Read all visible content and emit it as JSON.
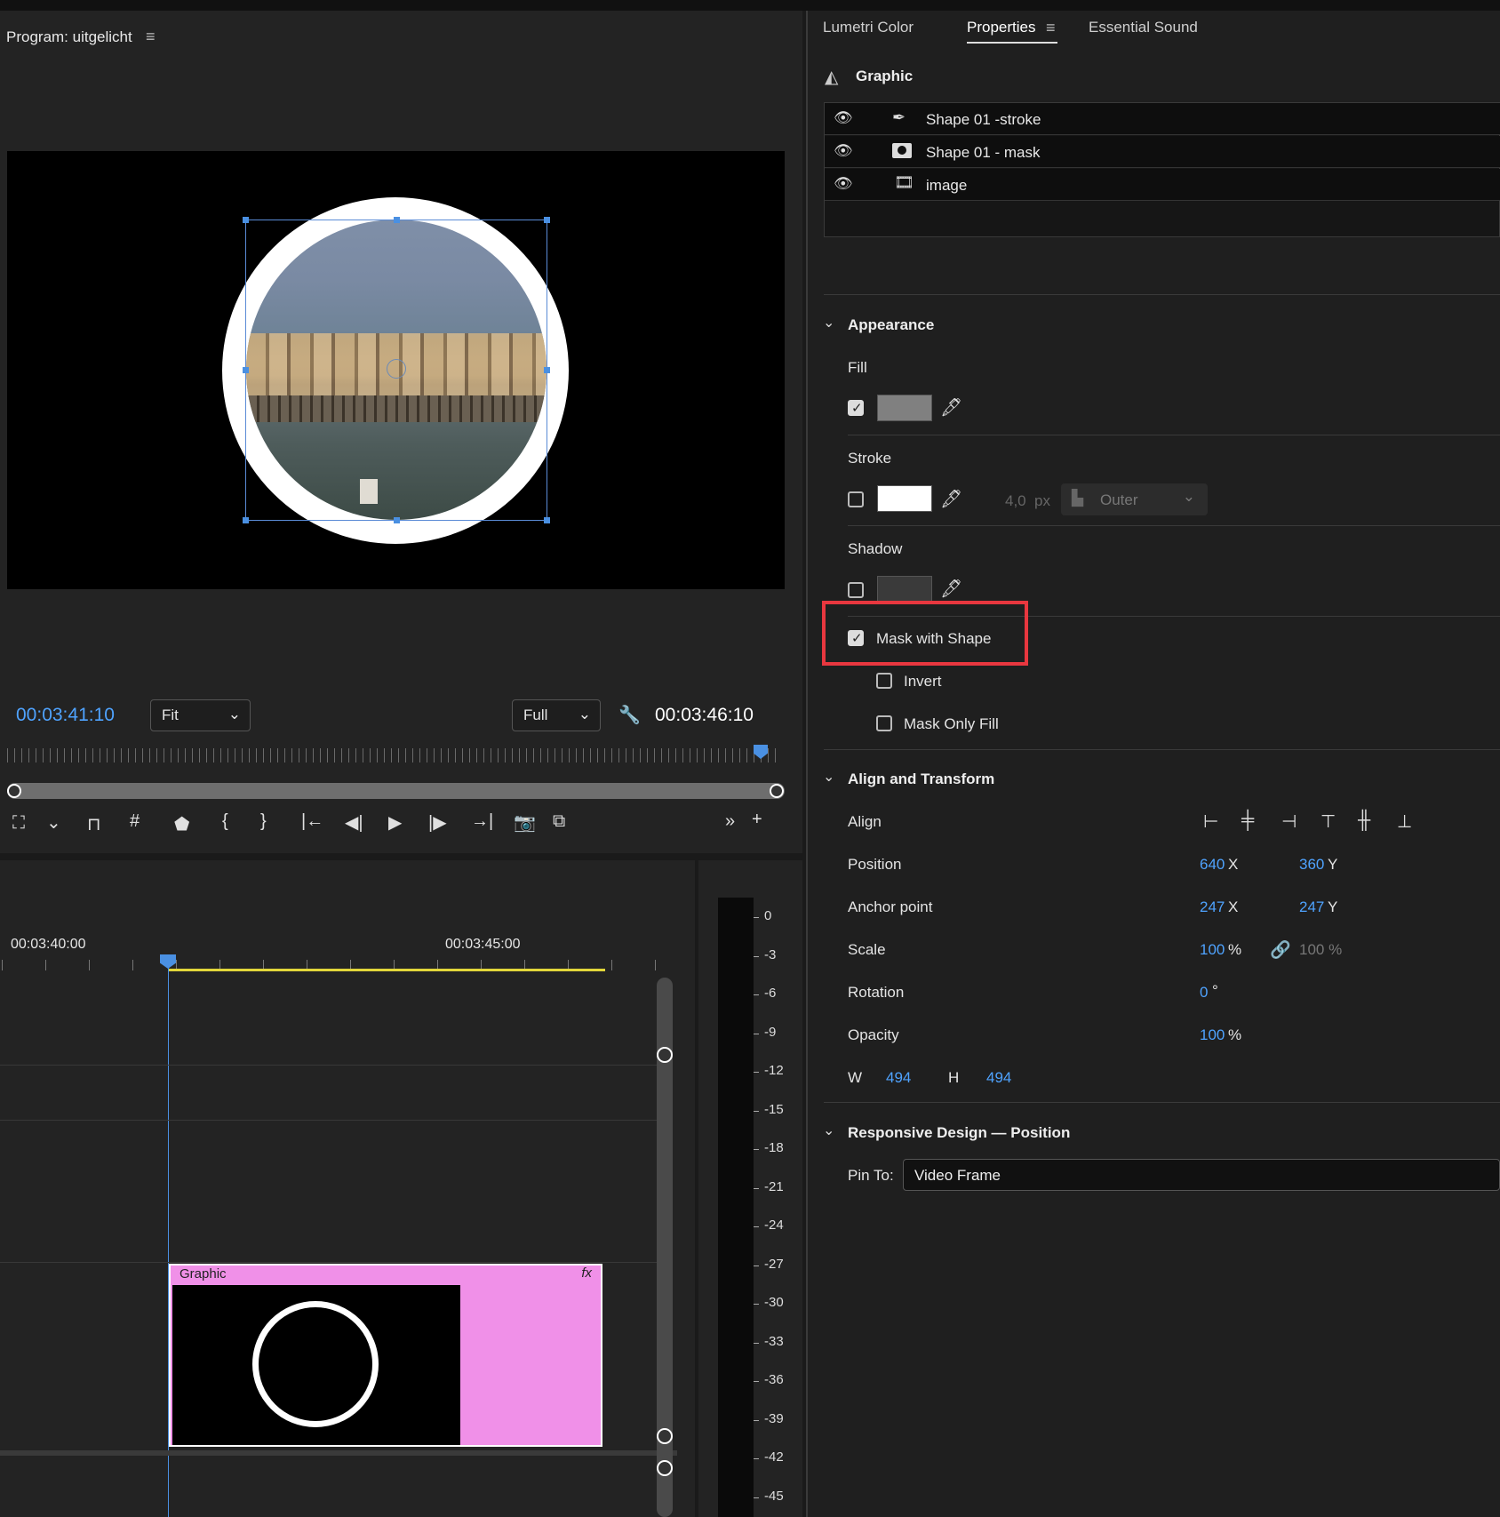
{
  "program": {
    "title": "Program: uitgelicht",
    "menu_icon": "hamburger-icon",
    "current_time": "00:03:41:10",
    "zoom": "Fit",
    "quality": "Full",
    "duration": "00:03:46:10"
  },
  "timeline": {
    "ruler_labels": [
      "00:03:40:00",
      "00:03:45:00"
    ],
    "clip_label": "Graphic",
    "clip_fx": "fx"
  },
  "meter": {
    "scale": [
      "0",
      "-3",
      "-6",
      "-9",
      "-12",
      "-15",
      "-18",
      "-21",
      "-24",
      "-27",
      "-30",
      "-33",
      "-36",
      "-39",
      "-42",
      "-45"
    ]
  },
  "panel": {
    "tabs": [
      "Lumetri Color",
      "Properties",
      "Essential Sound"
    ],
    "active_tab": "Properties",
    "graphic_title": "Graphic",
    "layers": [
      {
        "name": "Shape 01 -stroke",
        "icon": "pen-icon"
      },
      {
        "name": "Shape 01 - mask",
        "icon": "mask-icon"
      },
      {
        "name": "image",
        "icon": "film-icon"
      }
    ],
    "appearance": {
      "title": "Appearance",
      "fill_label": "Fill",
      "stroke_label": "Stroke",
      "stroke_width": "4,0",
      "stroke_unit": "px",
      "stroke_type": "Outer",
      "shadow_label": "Shadow",
      "mask_with_shape": "Mask with Shape",
      "invert": "Invert",
      "mask_only_fill": "Mask Only Fill"
    },
    "align_transform": {
      "title": "Align and Transform",
      "align_label": "Align",
      "position_label": "Position",
      "position_x": "640",
      "position_y": "360",
      "anchor_label": "Anchor point",
      "anchor_x": "247",
      "anchor_y": "247",
      "scale_label": "Scale",
      "scale_value": "100",
      "scale_value2": "100 %",
      "rotation_label": "Rotation",
      "rotation_value": "0",
      "opacity_label": "Opacity",
      "opacity_value": "100",
      "w_label": "W",
      "w_value": "494",
      "h_label": "H",
      "h_value": "494",
      "x_axis": "X",
      "y_axis": "Y",
      "percent": "%",
      "degree": "°"
    },
    "responsive": {
      "title": "Responsive Design — Position",
      "pin_label": "Pin To:",
      "pin_value": "Video Frame"
    }
  },
  "colors": {
    "accent_blue": "#4fa3ff",
    "highlight_red": "#e8373f",
    "clip_pink": "#f090e8",
    "work_area_yellow": "#e2d63a"
  }
}
